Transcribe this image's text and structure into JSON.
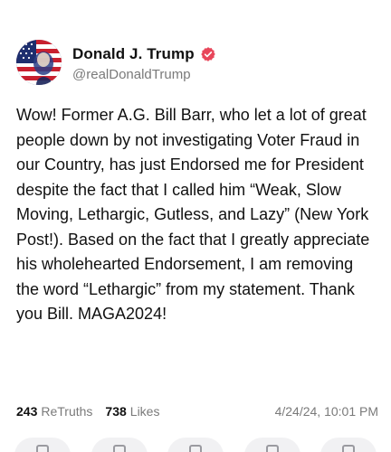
{
  "post": {
    "author": {
      "display_name": "Donald J. Trump",
      "handle": "@realDonaldTrump",
      "verified": true,
      "verified_color": "#e8465a",
      "avatar_icon": "american-flag-portrait"
    },
    "text": "Wow! Former A.G. Bill Barr, who let a lot of great people down by not investigating Voter Fraud in our Country, has just Endorsed me for President despite the fact that I called him “Weak, Slow Moving, Lethargic, Gutless, and Lazy” (New York Post!). Based on the fact that I greatly appreciate his wholehearted Endorsement, I am removing the word “Lethargic” from my statement. Thank you Bill. MAGA2024!",
    "stats": {
      "retruths_count": "243",
      "retruths_label": "ReTruths",
      "likes_count": "738",
      "likes_label": "Likes"
    },
    "timestamp": "4/24/24, 10:01 PM"
  },
  "actions": [
    {
      "icon": "reply-icon"
    },
    {
      "icon": "retruth-icon"
    },
    {
      "icon": "like-icon"
    },
    {
      "icon": "share-icon"
    },
    {
      "icon": "more-icon"
    }
  ],
  "colors": {
    "text_primary": "#111111",
    "text_secondary": "#7a7a7a",
    "background": "#ffffff",
    "action_bg": "#f1f1f3"
  }
}
